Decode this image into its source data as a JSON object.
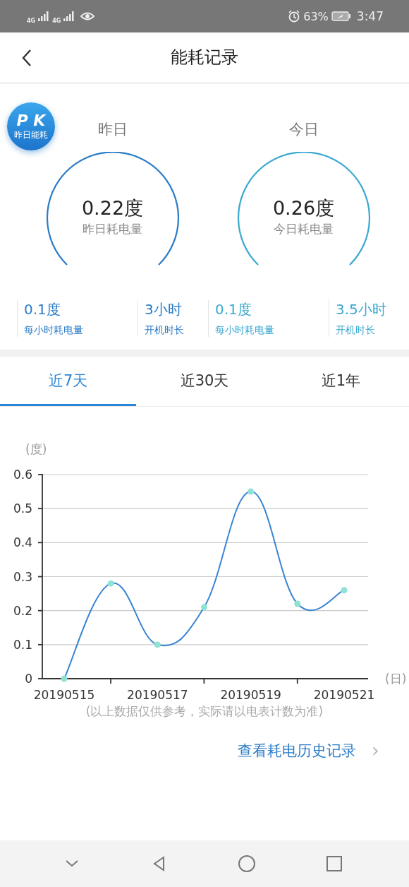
{
  "status_bar": {
    "network_labels": [
      "4G",
      "4G"
    ],
    "battery": "63%",
    "time": "3:47"
  },
  "header": {
    "title": "能耗记录"
  },
  "pk_badge": {
    "letters": "P K",
    "label": "昨日能耗"
  },
  "days": [
    {
      "title": "昨日",
      "amount": "0.22度",
      "amount_label": "昨日耗电量",
      "color": "#2a7bc8",
      "stats": [
        {
          "value": "0.1度",
          "label": "每小时耗电量"
        },
        {
          "value": "3小时",
          "label": "开机时长"
        }
      ]
    },
    {
      "title": "今日",
      "amount": "0.26度",
      "amount_label": "今日耗电量",
      "color": "#3aa8d0",
      "stats": [
        {
          "value": "0.1度",
          "label": "每小时耗电量"
        },
        {
          "value": "3.5小时",
          "label": "开机时长"
        }
      ]
    }
  ],
  "tabs": [
    {
      "label": "近7天",
      "selected": true
    },
    {
      "label": "近30天",
      "selected": false
    },
    {
      "label": "近1年",
      "selected": false
    }
  ],
  "chart_data": {
    "type": "line",
    "ylabel": "(度)",
    "xlabel": "(日)",
    "categories": [
      "20190515",
      null,
      "20190517",
      null,
      "20190519",
      null,
      "20190521"
    ],
    "yticks": [
      0,
      0.1,
      0.2,
      0.3,
      0.4,
      0.5,
      0.6
    ],
    "ylim": [
      0,
      0.6
    ],
    "grid": true,
    "series": [
      {
        "color": "#3a84d4",
        "marker": "circle",
        "values": [
          0,
          0.28,
          0.1,
          0.21,
          0.55,
          0.22,
          0.26
        ]
      }
    ]
  },
  "note": "(以上数据仅供参考，实际请以电表计数为准)",
  "history_link": {
    "label": "查看耗电历史记录",
    "arrow": "›"
  }
}
